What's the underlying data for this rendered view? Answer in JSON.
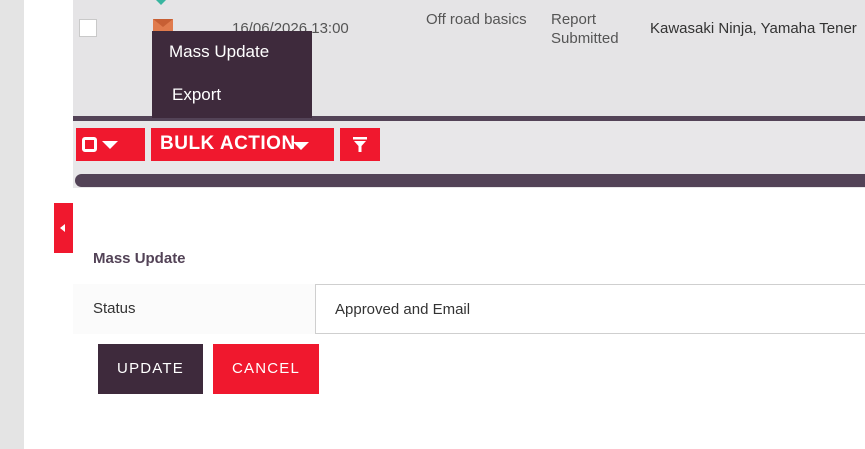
{
  "list": {
    "row": {
      "date": "16/06/2026 13:00",
      "course": "Off road basics",
      "status": "Report Submitted",
      "bikes": "Kawasaki Ninja, Yamaha Tener"
    }
  },
  "action_menu": {
    "items": [
      {
        "label": "Mass Update"
      },
      {
        "label": "Export"
      }
    ]
  },
  "toolbar": {
    "bulk_action_label": "BULK ACTION"
  },
  "mass_update": {
    "title": "Mass Update",
    "status_label": "Status",
    "status_value": "Approved and Email",
    "update_label": "UPDATE",
    "cancel_label": "CANCEL"
  },
  "colors": {
    "accent_red": "#f0182e",
    "brand_purple": "#3e2a3c"
  },
  "icons": {
    "select": "checkbox-square-icon",
    "caret": "chevron-down-icon",
    "filter": "filter-icon",
    "email": "envelope-icon",
    "collapse": "chevron-left-icon"
  }
}
